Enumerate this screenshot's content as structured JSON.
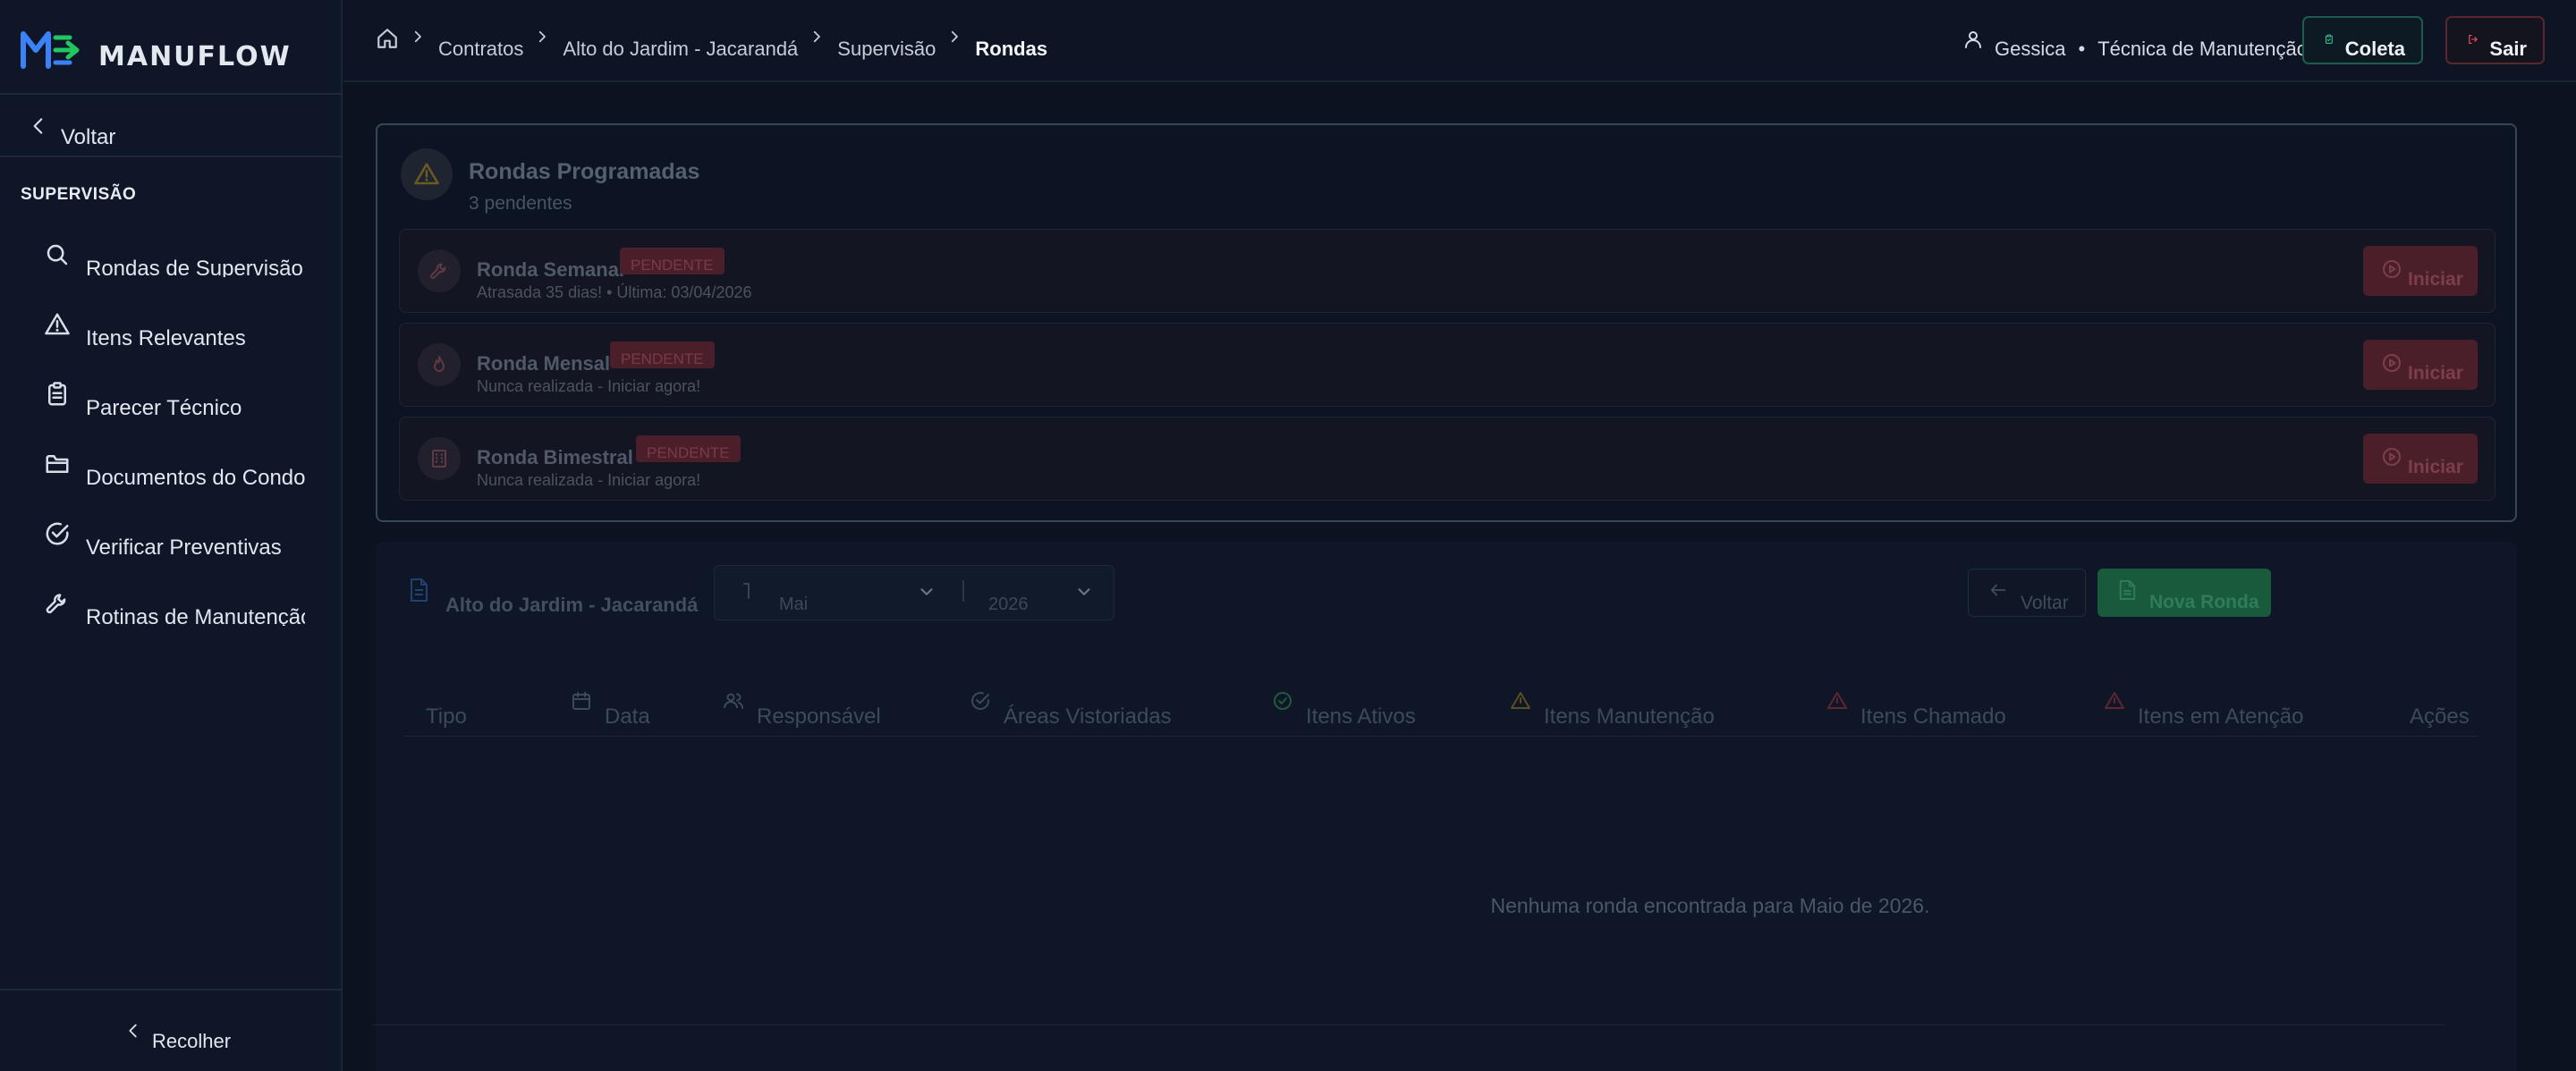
{
  "brand": {
    "name": "MANUFLOW",
    "accent": "#3b82f6",
    "accent2": "#22c55e"
  },
  "sidebar": {
    "back_label": "Voltar",
    "section_title": "SUPERVISÃO",
    "items": [
      {
        "label": "Rondas de Supervisão",
        "icon": "search-icon"
      },
      {
        "label": "Itens Relevantes",
        "icon": "warning-icon"
      },
      {
        "label": "Parecer Técnico",
        "icon": "clipboard-icon"
      },
      {
        "label": "Documentos do Condomínio",
        "icon": "folder-icon"
      },
      {
        "label": "Verificar Preventivas",
        "icon": "check-circle-icon"
      },
      {
        "label": "Rotinas de Manutenção",
        "icon": "wrench-icon"
      }
    ],
    "collapse_label": "Recolher"
  },
  "header": {
    "breadcrumbs": [
      "Contratos",
      "Alto do Jardim - Jacarandá",
      "Supervisão",
      "Rondas"
    ],
    "user_name": "Gessica",
    "user_role": "Técnica de Manutenção",
    "separator": "•",
    "coleta_label": "Coleta",
    "sair_label": "Sair"
  },
  "rondas": {
    "title": "Rondas Programadas",
    "subtitle": "3 pendentes",
    "items": [
      {
        "name": "Ronda Semanal",
        "badge": "PENDENTE",
        "meta": "Atrasada 35 dias!  •  Última: 03/04/2026",
        "action": "Iniciar",
        "icon": "wrench-icon"
      },
      {
        "name": "Ronda Mensal",
        "badge": "PENDENTE",
        "meta": "Nunca realizada - Iniciar agora!",
        "action": "Iniciar",
        "icon": "flame-icon"
      },
      {
        "name": "Ronda Bimestral",
        "badge": "PENDENTE",
        "meta": "Nunca realizada - Iniciar agora!",
        "action": "Iniciar",
        "icon": "building-icon"
      }
    ]
  },
  "table": {
    "title": "Alto do Jardim - Jacarandá",
    "month": "Mai",
    "year": "2026",
    "back_label": "Voltar",
    "new_label": "Nova Ronda",
    "columns": [
      "Tipo",
      "Data",
      "Responsável",
      "Áreas Vistoriadas",
      "Itens Ativos",
      "Itens Manutenção",
      "Itens Chamado",
      "Itens em Atenção",
      "Ações"
    ],
    "empty_message": "Nenhuma ronda encontrada para Maio de 2026."
  },
  "colors": {
    "pending_bg": "#4a1f2a",
    "pending_text": "#7a3a45",
    "success": "#1a5a3c",
    "warning": "#b58a1a",
    "danger": "#b03040"
  }
}
